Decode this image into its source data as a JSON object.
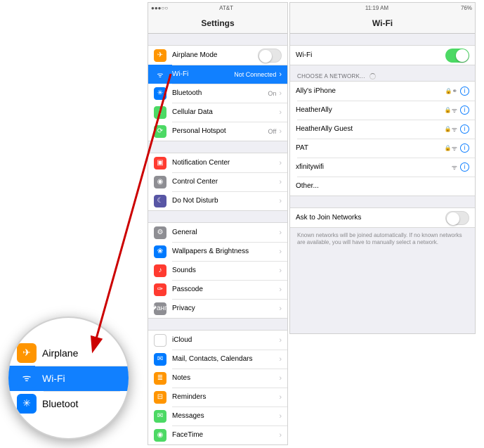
{
  "left": {
    "status": {
      "carrier": "AT&T",
      "signal": "●●●○○"
    },
    "title": "Settings",
    "group1": [
      {
        "icon": "✈",
        "bg": "bg-orange",
        "label": "Airplane Mode",
        "control": "toggle-off"
      },
      {
        "icon": "ᯤ",
        "bg": "bg-blue",
        "label": "Wi-Fi",
        "value": "Not Connected",
        "selected": true
      },
      {
        "icon": "✳",
        "bg": "bg-blue2",
        "label": "Bluetooth",
        "value": "On"
      },
      {
        "icon": "⟟",
        "bg": "bg-green",
        "label": "Cellular Data"
      },
      {
        "icon": "⟳",
        "bg": "bg-green",
        "label": "Personal Hotspot",
        "value": "Off"
      }
    ],
    "group2": [
      {
        "icon": "▣",
        "bg": "bg-red",
        "label": "Notification Center"
      },
      {
        "icon": "◉",
        "bg": "bg-gray",
        "label": "Control Center"
      },
      {
        "icon": "☾",
        "bg": "bg-moon",
        "label": "Do Not Disturb"
      }
    ],
    "group3": [
      {
        "icon": "⚙",
        "bg": "bg-gray",
        "label": "General"
      },
      {
        "icon": "❀",
        "bg": "bg-blue2",
        "label": "Wallpapers & Brightness"
      },
      {
        "icon": "♪",
        "bg": "bg-red",
        "label": "Sounds"
      },
      {
        "icon": "✑",
        "bg": "bg-red",
        "label": "Passcode"
      },
      {
        "icon": "�англ",
        "bg": "bg-gray",
        "label": "Privacy"
      }
    ],
    "group4": [
      {
        "icon": "☁",
        "bg": "bg-cloud",
        "label": "iCloud"
      },
      {
        "icon": "✉",
        "bg": "bg-blue2",
        "label": "Mail, Contacts, Calendars"
      },
      {
        "icon": "≣",
        "bg": "bg-orange",
        "label": "Notes"
      },
      {
        "icon": "⊟",
        "bg": "bg-orange",
        "label": "Reminders"
      },
      {
        "icon": "✉",
        "bg": "bg-green",
        "label": "Messages"
      },
      {
        "icon": "◉",
        "bg": "bg-green",
        "label": "FaceTime"
      }
    ]
  },
  "right": {
    "status": {
      "time": "11:19 AM",
      "battery": "76%"
    },
    "title": "Wi-Fi",
    "wifi_toggle_label": "Wi-Fi",
    "choose_hdr": "CHOOSE A NETWORK...",
    "networks": [
      {
        "name": "Ally's iPhone",
        "lock": true,
        "wifi": true,
        "special": true
      },
      {
        "name": "HeatherAlly",
        "lock": true,
        "wifi": true
      },
      {
        "name": "HeatherAlly Guest",
        "lock": true,
        "wifi": true
      },
      {
        "name": "PAT",
        "lock": true,
        "wifi": true
      },
      {
        "name": "xfinitywifi",
        "lock": false,
        "wifi": true
      }
    ],
    "other": "Other...",
    "ask": "Ask to Join Networks",
    "note": "Known networks will be joined automatically. If no known networks are available, you will have to manually select a network."
  },
  "mag": {
    "rows": [
      {
        "icon": "✈",
        "bg": "bg-orange",
        "label": "Airplane "
      },
      {
        "icon": "ᯤ",
        "bg": "bg-blue",
        "label": "Wi-Fi",
        "sel": true
      },
      {
        "icon": "✳",
        "bg": "bg-blue2",
        "label": "Bluetoot"
      }
    ]
  }
}
